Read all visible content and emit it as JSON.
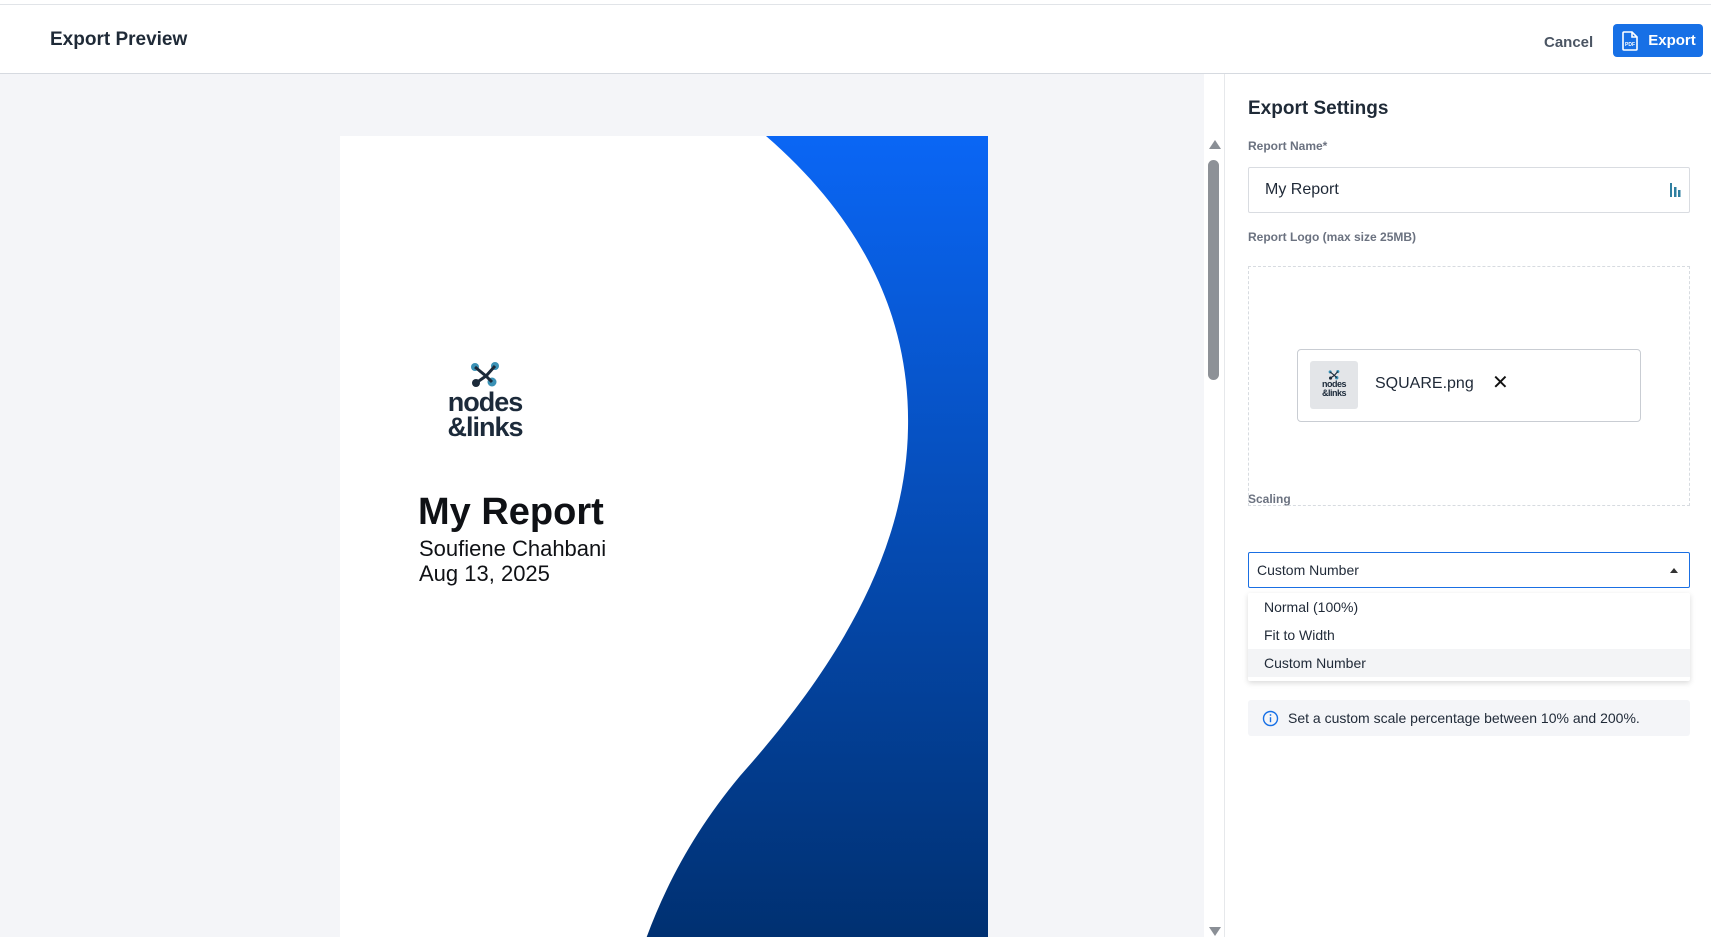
{
  "header": {
    "title": "Export Preview",
    "cancel_label": "Cancel",
    "export_label": "Export",
    "export_icon": "pdf-file-icon"
  },
  "preview": {
    "logo_line1": "nodes",
    "logo_line2": "&links",
    "report_title": "My Report",
    "author": "Soufiene Chahbani",
    "date": "Aug 13, 2025"
  },
  "settings": {
    "title": "Export Settings",
    "report_name_label": "Report Name*",
    "report_name_value": "My Report",
    "logo_label": "Report Logo (max size 25MB)",
    "logo_file_name": "SQUARE.png",
    "remove_symbol": "✕",
    "scaling_label": "Scaling",
    "scaling_selected": "Custom Number",
    "scaling_options": [
      "Normal (100%)",
      "Fit to Width",
      "Custom Number"
    ],
    "hint": "Set a custom scale percentage between 10% and 200%."
  },
  "colors": {
    "accent": "#1770e6",
    "wave_top": "#0a66f5",
    "wave_bottom": "#002f6e",
    "logo_teal": "#3a91b5"
  }
}
